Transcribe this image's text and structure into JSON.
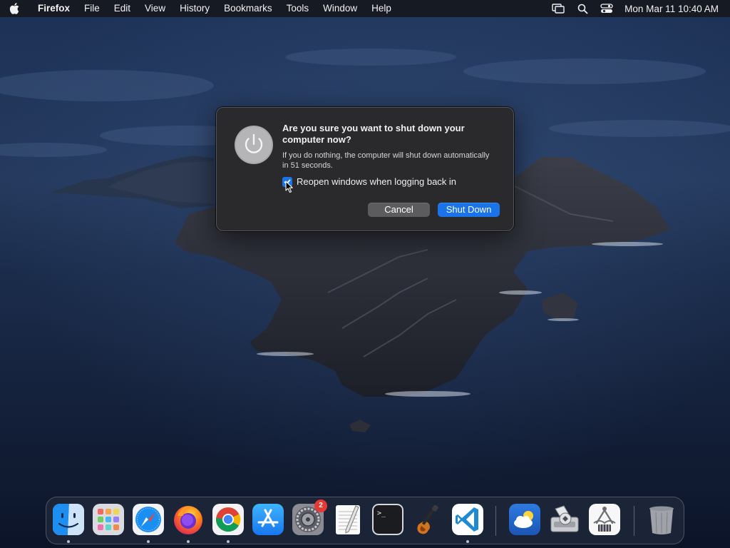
{
  "menubar": {
    "app_name": "Firefox",
    "menus": [
      "File",
      "Edit",
      "View",
      "History",
      "Bookmarks",
      "Tools",
      "Window",
      "Help"
    ],
    "status_icons": [
      "screen-mirroring-icon",
      "spotlight-search-icon",
      "control-center-icon"
    ],
    "clock": "Mon Mar 11  10:40 AM"
  },
  "dialog": {
    "title": "Are you sure you want to shut down your computer now?",
    "message": "If you do nothing, the computer will shut down automatically in 51 seconds.",
    "checkbox_label": "Reopen windows when logging back in",
    "checkbox_checked": true,
    "cancel_label": "Cancel",
    "shutdown_label": "Shut Down",
    "accent_color": "#1a73e8"
  },
  "dock": {
    "items": [
      {
        "name": "Finder",
        "icon": "finder-icon",
        "running": true
      },
      {
        "name": "Launchpad",
        "icon": "launchpad-icon",
        "running": false
      },
      {
        "name": "Safari",
        "icon": "safari-icon",
        "running": true
      },
      {
        "name": "Firefox",
        "icon": "firefox-icon",
        "running": true
      },
      {
        "name": "Google Chrome",
        "icon": "chrome-icon",
        "running": true
      },
      {
        "name": "App Store",
        "icon": "app-store-icon",
        "running": false
      },
      {
        "name": "System Preferences",
        "icon": "system-preferences-icon",
        "running": false,
        "badge": "2"
      },
      {
        "name": "TextEdit",
        "icon": "textedit-icon",
        "running": false
      },
      {
        "name": "Terminal",
        "icon": "terminal-icon",
        "running": false
      },
      {
        "name": "GarageBand",
        "icon": "garageband-icon",
        "running": false
      },
      {
        "name": "Visual Studio Code",
        "icon": "vscode-icon",
        "running": true
      },
      {
        "name": "Weather",
        "icon": "weather-icon",
        "running": false
      },
      {
        "name": "Disk Utility",
        "icon": "disk-utility-icon",
        "running": false
      },
      {
        "name": "System Information",
        "icon": "system-information-icon",
        "running": false
      },
      {
        "name": "Trash",
        "icon": "trash-icon",
        "running": false
      }
    ]
  }
}
